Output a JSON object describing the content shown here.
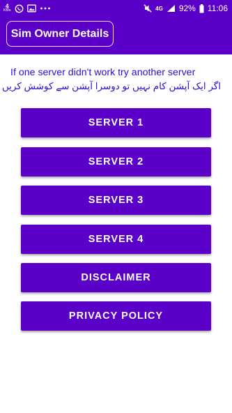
{
  "status_bar": {
    "net_speed_value": "4",
    "net_speed_unit": "KB/s",
    "left_icons": [
      "whatsapp-icon",
      "image-icon",
      "more-icon"
    ],
    "right_icons": [
      "mute-icon",
      "4g-lte-icon",
      "signal-icon"
    ],
    "network_label": "4G",
    "battery": "92%",
    "time": "11:06"
  },
  "app_bar": {
    "title": "Sim Owner Details"
  },
  "info": {
    "english": "If one server didn't work try another server",
    "urdu": "اگر ایک آپشن کام نہیں تو دوسرا آپشن سے کوشش کریں"
  },
  "buttons": [
    {
      "label": "SERVER 1"
    },
    {
      "label": "SERVER 2"
    },
    {
      "label": "SERVER 3"
    },
    {
      "label": "SERVER 4"
    },
    {
      "label": "DISCLAIMER"
    },
    {
      "label": "PRIVACY POLICY"
    }
  ],
  "colors": {
    "primary": "#5a00c8",
    "info_text": "#2a0fd4",
    "background": "#ffffff"
  }
}
